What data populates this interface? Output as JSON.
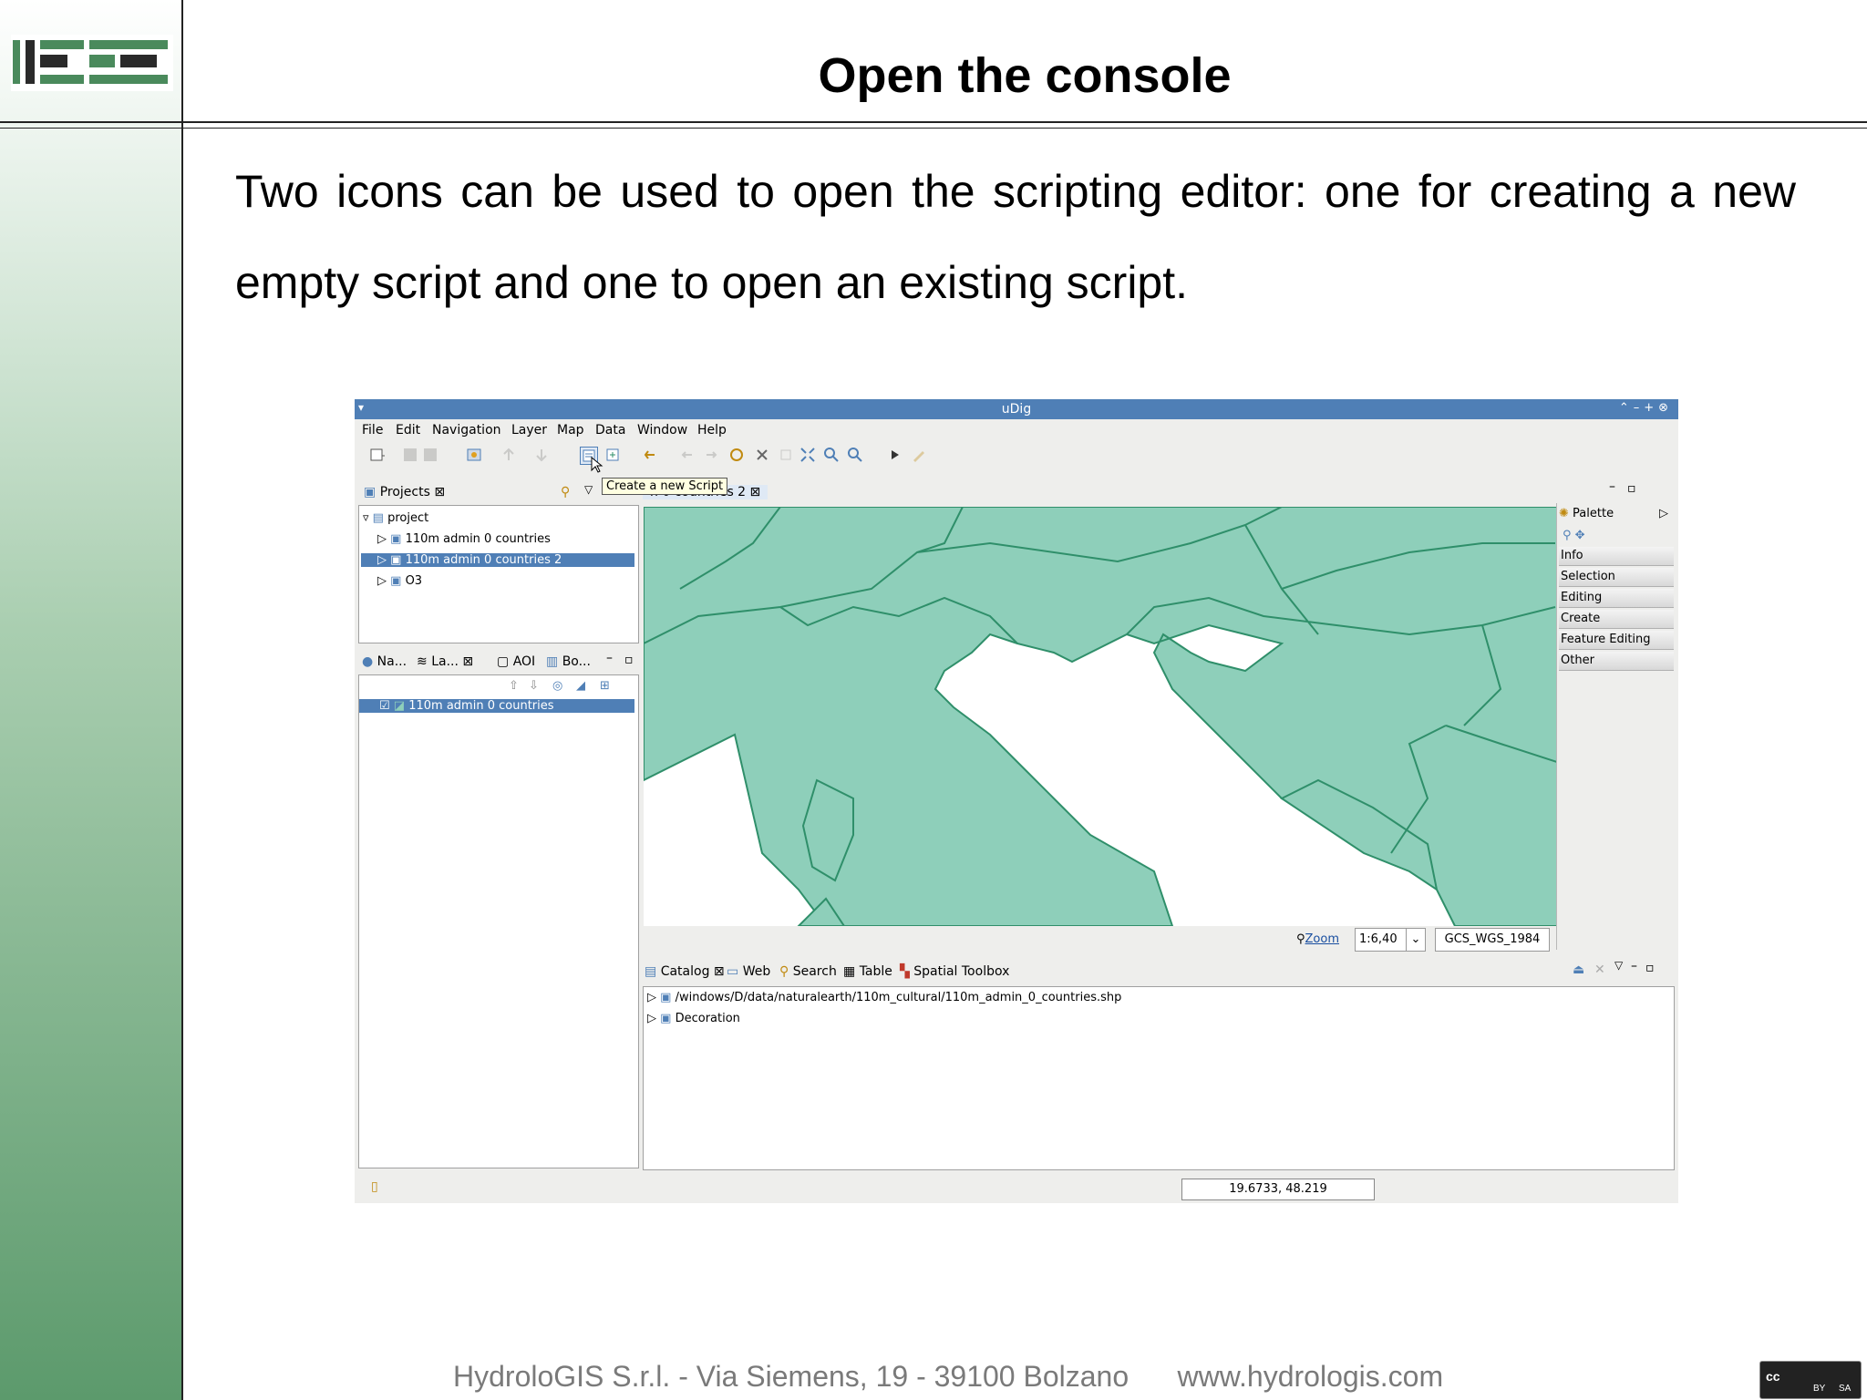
{
  "slide": {
    "title": "Open the console",
    "body": "Two icons can be used to open the scripting editor: one for creating a new empty script and one to open an existing script.",
    "footer": "HydroloGIS S.r.l. - Via Siemens, 19 - 39100 Bolzano      www.hydrologis.com",
    "license": {
      "cc": "cc",
      "by": "BY",
      "sa": "SA"
    }
  },
  "colors": {
    "map_fill": "#8ecfba",
    "map_stroke": "#2f8f6a",
    "selection": "#4f7fb6",
    "titlebar": "#4f7fb6"
  },
  "window": {
    "title": "uDig",
    "menu": [
      "File",
      "Edit",
      "Navigation",
      "Layer",
      "Map",
      "Data",
      "Window",
      "Help"
    ],
    "tooltip": "Create a new Script",
    "projects": {
      "tab": "Projects",
      "root": "project",
      "items": [
        "110m admin 0 countries",
        "110m admin 0 countries 2",
        "O3"
      ],
      "selected_index": 1
    },
    "map_tab": "n 0 countries 2",
    "layers": {
      "tabs": [
        "Na...",
        "La...",
        "AOI",
        "Bo..."
      ],
      "items": [
        "110m admin 0 countries"
      ]
    },
    "palette": {
      "title": "Palette",
      "items": [
        "Info",
        "Selection",
        "Editing",
        "Create",
        "Feature Editing",
        "Other"
      ]
    },
    "map_status": {
      "zoom_link": "Zoom",
      "scale": "1:6,40",
      "crs": "GCS_WGS_1984"
    },
    "catalog": {
      "tabs": [
        "Catalog",
        "Web",
        "Search",
        "Table",
        "Spatial Toolbox"
      ],
      "items": [
        "/windows/D/data/naturalearth/110m_cultural/110m_admin_0_countries.shp",
        "Decoration"
      ]
    },
    "status": {
      "coordinates": "19.6733, 48.219"
    }
  }
}
